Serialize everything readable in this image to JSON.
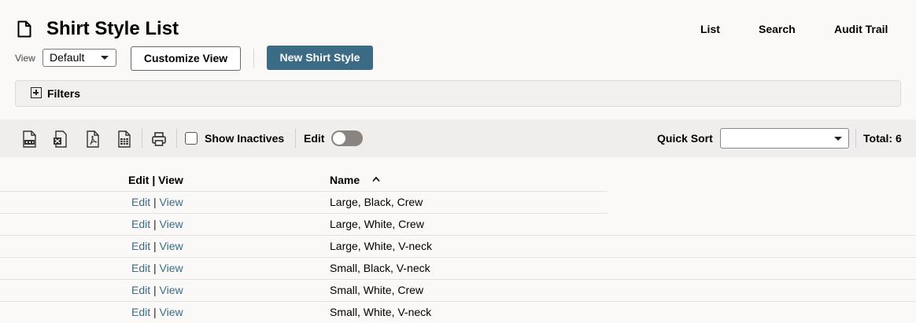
{
  "header": {
    "title": "Shirt Style List",
    "nav": [
      {
        "label": "List"
      },
      {
        "label": "Search"
      },
      {
        "label": "Audit Trail"
      }
    ]
  },
  "controls": {
    "view_label": "View",
    "view_value": "Default",
    "customize_label": "Customize View",
    "new_label": "New Shirt Style"
  },
  "filters": {
    "label": "Filters"
  },
  "toolbar": {
    "export_icons": [
      "export-csv-icon",
      "export-excel-icon",
      "export-pdf-icon",
      "export-spreadsheet-icon"
    ],
    "print_icon": "print-icon",
    "show_inactives_label": "Show Inactives",
    "show_inactives_checked": false,
    "edit_label": "Edit",
    "edit_enabled": false,
    "quick_sort_label": "Quick Sort",
    "quick_sort_value": "",
    "total_label": "Total: 6"
  },
  "grid": {
    "columns": {
      "actions": "Edit | View",
      "name": "Name"
    },
    "sort": {
      "column": "name",
      "direction": "ascending"
    },
    "edit_link": "Edit",
    "separator": "|",
    "view_link": "View",
    "rows": [
      {
        "name": "Large, Black, Crew"
      },
      {
        "name": "Large, White, Crew"
      },
      {
        "name": "Large, White, V-neck"
      },
      {
        "name": "Small, Black, V-neck"
      },
      {
        "name": "Small, White, Crew"
      },
      {
        "name": "Small, White, V-neck"
      }
    ]
  },
  "colors": {
    "accent": "#3b6b85",
    "toolbar_bg": "#efeeed",
    "page_bg": "#faf9f8",
    "toggle_off": "#8a8480"
  }
}
